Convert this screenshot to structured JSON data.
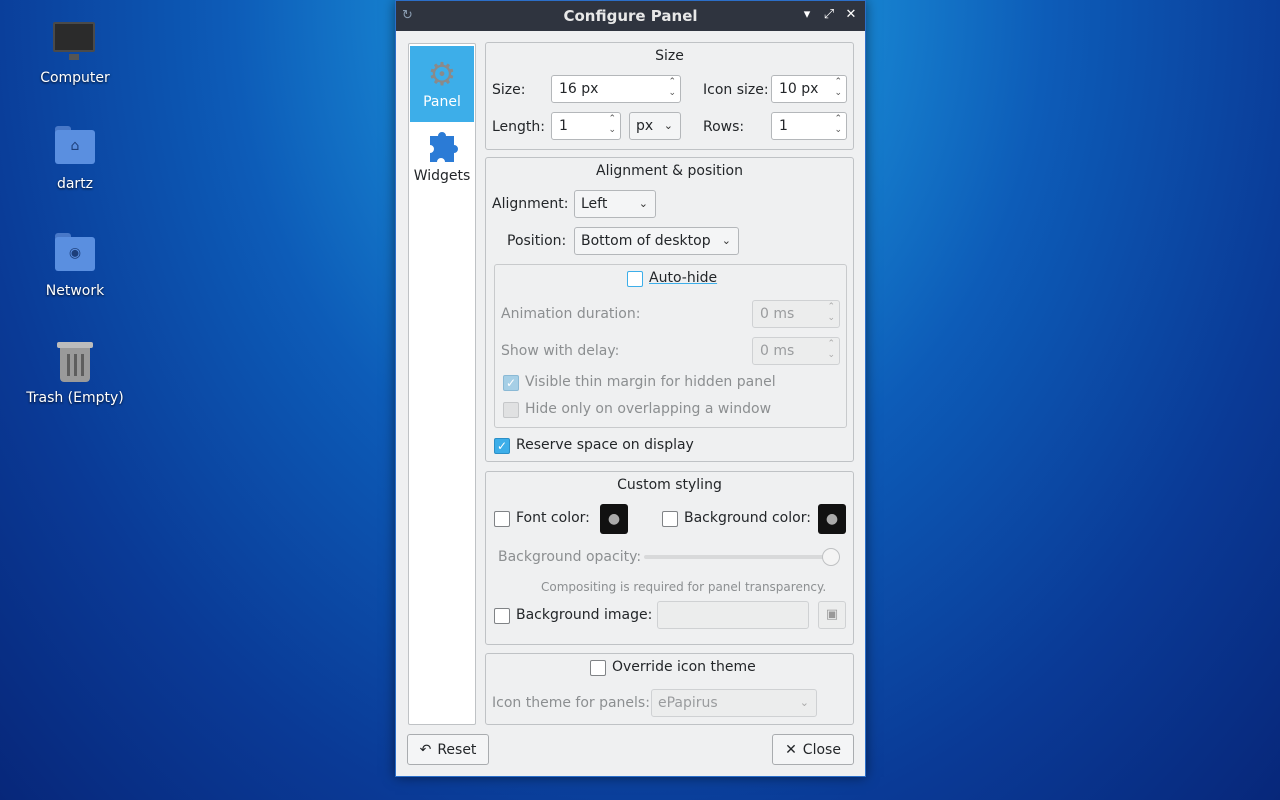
{
  "desktop": {
    "icons": [
      {
        "label": "Computer"
      },
      {
        "label": "dartz"
      },
      {
        "label": "Network"
      },
      {
        "label": "Trash (Empty)"
      }
    ]
  },
  "window": {
    "title": "Configure Panel",
    "controls": {
      "minimize": "▾",
      "maximize": "⤢",
      "close": "✕"
    },
    "sidebar": {
      "items": [
        {
          "label": "Panel",
          "icon": "gear-icon",
          "active": true
        },
        {
          "label": "Widgets",
          "icon": "puzzle-icon",
          "active": false
        }
      ]
    },
    "size_group": {
      "title": "Size",
      "size_label": "Size:",
      "size_value": "16 px",
      "icon_size_label": "Icon size:",
      "icon_size_value": "10 px",
      "length_label": "Length:",
      "length_value": "1",
      "length_unit": "px",
      "rows_label": "Rows:",
      "rows_value": "1"
    },
    "alignment_group": {
      "title": "Alignment & position",
      "alignment_label": "Alignment:",
      "alignment_value": "Left",
      "position_label": "Position:",
      "position_value": "Bottom of desktop",
      "autohide_label": "Auto-hide",
      "autohide_checked": false,
      "animation_label": "Animation duration:",
      "animation_value": "0 ms",
      "delay_label": "Show with delay:",
      "delay_value": "0 ms",
      "thin_margin_label": "Visible thin margin for hidden panel",
      "thin_margin_checked": true,
      "overlap_label": "Hide only on overlapping a window",
      "overlap_checked": false,
      "reserve_label": "Reserve space on display",
      "reserve_checked": true
    },
    "styling_group": {
      "title": "Custom styling",
      "font_color_label": "Font color:",
      "bg_color_label": "Background color:",
      "opacity_label": "Background opacity:",
      "opacity_value": 1.0,
      "compositing_note": "Compositing is required for panel transparency.",
      "bg_image_label": "Background image:"
    },
    "icon_theme_group": {
      "override_label": "Override icon theme",
      "theme_label": "Icon theme for panels:",
      "theme_value": "ePapirus"
    },
    "buttons": {
      "reset": "Reset",
      "close": "Close"
    }
  }
}
